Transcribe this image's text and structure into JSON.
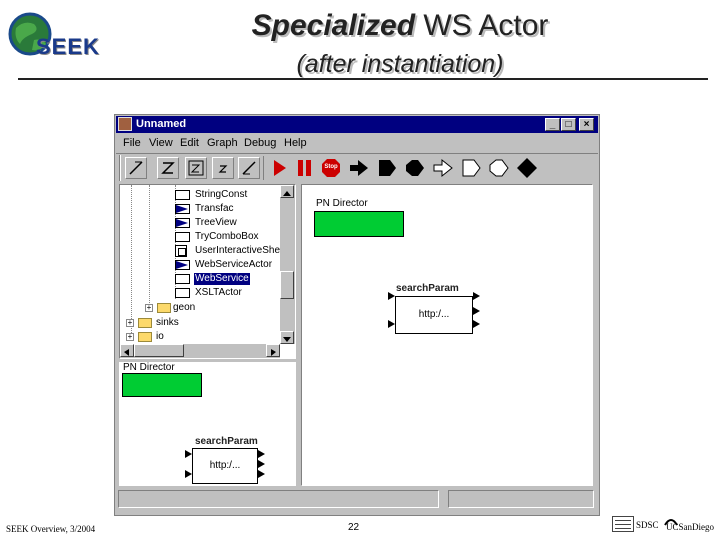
{
  "slide": {
    "title_bold": "Specialized",
    "title_rest": "WS Actor",
    "subtitle": "(after instantiation)",
    "logo_text": "SEEK",
    "footer_left": "SEEK Overview, 3/2004",
    "page_number": "22",
    "footer_logo_sdsc": "SDSC",
    "footer_logo_ucsd": "UCSanDiego"
  },
  "window": {
    "title": "Unnamed",
    "controls": [
      "_",
      "□",
      "×"
    ],
    "menu": [
      "File",
      "View",
      "Edit",
      "Graph",
      "Debug",
      "Help"
    ],
    "toolbar_icons": [
      "zoom-in-icon",
      "zoom-reset-icon",
      "zoom-fit-icon",
      "zoom-small-icon",
      "zoom-out-icon",
      "run-icon",
      "pause-icon",
      "stop-icon",
      "port-input-icon",
      "port-output-icon",
      "port-io-icon",
      "port-multi-input-icon",
      "port-multi-output-icon",
      "port-multi-io-icon",
      "relation-icon"
    ],
    "stop_label": "Stop"
  },
  "tree": {
    "items": [
      {
        "label": "StringConst",
        "icon": "actor-icon",
        "selected": false
      },
      {
        "label": "Transfac",
        "icon": "actor-icon",
        "selected": false
      },
      {
        "label": "TreeView",
        "icon": "actor-icon",
        "selected": false
      },
      {
        "label": "TryComboBox",
        "icon": "actor-icon",
        "selected": false
      },
      {
        "label": "UserInteractiveShell",
        "icon": "actor-icon",
        "selected": false
      },
      {
        "label": "WebServiceActor",
        "icon": "actor-icon",
        "selected": false
      },
      {
        "label": "WebService",
        "icon": "actor-icon",
        "selected": true
      },
      {
        "label": "XSLTActor",
        "icon": "actor-icon",
        "selected": false
      }
    ],
    "folders": [
      {
        "label": "geon"
      },
      {
        "label": "sinks"
      },
      {
        "label": "io"
      }
    ]
  },
  "canvas_right": {
    "director_label": "PN Director",
    "actor_title": "searchParam",
    "actor_text": "http:/..."
  },
  "canvas_left": {
    "director_label": "PN Director",
    "actor_title": "searchParam",
    "actor_text": "http:/..."
  },
  "colors": {
    "titlebar": "#000080",
    "director": "#00cc33",
    "window_bg": "#c0c0c0",
    "selection": "#000080"
  }
}
